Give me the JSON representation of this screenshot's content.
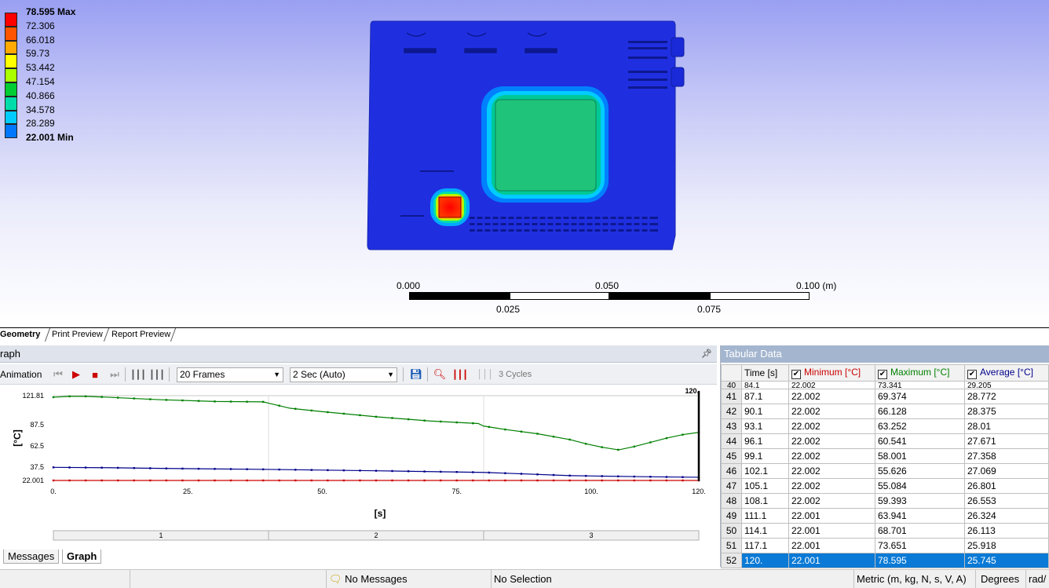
{
  "legend": {
    "items": [
      {
        "label": "78.595 Max",
        "color": "#ff0000",
        "bold": true
      },
      {
        "label": "72.306",
        "color": "#ff5500",
        "bold": false
      },
      {
        "label": "66.018",
        "color": "#ffaa00",
        "bold": false
      },
      {
        "label": "59.73",
        "color": "#ffff00",
        "bold": false
      },
      {
        "label": "53.442",
        "color": "#aaff00",
        "bold": false
      },
      {
        "label": "47.154",
        "color": "#00cc33",
        "bold": false
      },
      {
        "label": "40.866",
        "color": "#00ddaa",
        "bold": false
      },
      {
        "label": "34.578",
        "color": "#00ccff",
        "bold": false
      },
      {
        "label": "28.289",
        "color": "#0077ff",
        "bold": false
      },
      {
        "label": "22.001 Min",
        "color": "#0000ff",
        "bold": true
      }
    ]
  },
  "scale_bar": {
    "top_labels": [
      "0.000",
      "0.050",
      "0.100 (m)"
    ],
    "bottom_labels": [
      "0.025",
      "0.075"
    ]
  },
  "view_tabs": [
    "Geometry",
    "Print Preview",
    "Report Preview"
  ],
  "graph": {
    "title": "raph",
    "animation_label": "Animation",
    "frames_value": "20 Frames",
    "duration_value": "2 Sec (Auto)",
    "cycles_label": "3 Cycles",
    "pin_icon": "pin-icon"
  },
  "chart_data": {
    "type": "line",
    "xlabel": "[s]",
    "ylabel": "[°C]",
    "xlim": [
      0,
      120
    ],
    "ylim": [
      22.001,
      121.81
    ],
    "x_ticks": [
      "0.",
      "25.",
      "50.",
      "75.",
      "100.",
      "120."
    ],
    "x_tick_values": [
      0,
      25,
      50,
      75,
      100,
      120
    ],
    "y_ticks": [
      "121.81",
      "87.5",
      "62.5",
      "37.5",
      "22.001"
    ],
    "y_tick_values": [
      121.81,
      87.5,
      62.5,
      37.5,
      22.001
    ],
    "current_time_label": "120.",
    "current_time": 120,
    "step_labels": [
      "1",
      "2",
      "3"
    ],
    "step_bounds": [
      0,
      40,
      80,
      120
    ],
    "series": [
      {
        "name": "Minimum [°C]",
        "color": "#cc0000",
        "x": [
          0,
          20,
          40,
          60,
          80,
          100,
          120
        ],
        "y": [
          22.0,
          22.0,
          22.0,
          22.0,
          22.0,
          22.0,
          22.001
        ]
      },
      {
        "name": "Maximum [°C]",
        "color": "#008000",
        "x": [
          0,
          3,
          6,
          10,
          20,
          30,
          39,
          40,
          44,
          50,
          60,
          70,
          79,
          80,
          84,
          90,
          96.1,
          99.1,
          102.1,
          105.1,
          108.1,
          111.1,
          114.1,
          117.1,
          120
        ],
        "y": [
          120,
          121,
          121,
          120,
          117,
          115,
          114.5,
          113,
          107,
          103,
          97,
          92,
          89,
          86,
          82,
          77,
          70,
          65,
          61,
          58,
          62,
          67,
          72,
          76,
          78.595
        ]
      },
      {
        "name": "Average [°C]",
        "color": "#00008b",
        "x": [
          0,
          10,
          20,
          40,
          60,
          80,
          96.1,
          102.1,
          108.1,
          114.1,
          120
        ],
        "y": [
          37.4,
          37.0,
          36.2,
          35.0,
          33.4,
          31.5,
          27.671,
          27.069,
          26.553,
          26.113,
          25.745
        ]
      }
    ]
  },
  "bottom_tabs": [
    "Messages",
    "Graph"
  ],
  "tabular": {
    "title": "Tabular Data",
    "headers": [
      "Time [s]",
      "Minimum [°C]",
      "Maximum [°C]",
      "Average [°C]"
    ],
    "header_colors": [
      "#000000",
      "#cc0000",
      "#008000",
      "#00008b"
    ],
    "clipped_row": [
      "40",
      "84.1",
      "22.002",
      "73.341",
      "29.205"
    ],
    "rows": [
      [
        "41",
        "87.1",
        "22.002",
        "69.374",
        "28.772"
      ],
      [
        "42",
        "90.1",
        "22.002",
        "66.128",
        "28.375"
      ],
      [
        "43",
        "93.1",
        "22.002",
        "63.252",
        "28.01"
      ],
      [
        "44",
        "96.1",
        "22.002",
        "60.541",
        "27.671"
      ],
      [
        "45",
        "99.1",
        "22.002",
        "58.001",
        "27.358"
      ],
      [
        "46",
        "102.1",
        "22.002",
        "55.626",
        "27.069"
      ],
      [
        "47",
        "105.1",
        "22.002",
        "55.084",
        "26.801"
      ],
      [
        "48",
        "108.1",
        "22.002",
        "59.393",
        "26.553"
      ],
      [
        "49",
        "111.1",
        "22.001",
        "63.941",
        "26.324"
      ],
      [
        "50",
        "114.1",
        "22.001",
        "68.701",
        "26.113"
      ],
      [
        "51",
        "117.1",
        "22.001",
        "73.651",
        "25.918"
      ],
      [
        "52",
        "120.",
        "22.001",
        "78.595",
        "25.745"
      ]
    ],
    "selected_row": "52"
  },
  "status_bar": {
    "messages": "No Messages",
    "selection": "No Selection",
    "units": "Metric (m, kg, N, s, V, A)",
    "angle": "Degrees",
    "rate": "rad/"
  }
}
